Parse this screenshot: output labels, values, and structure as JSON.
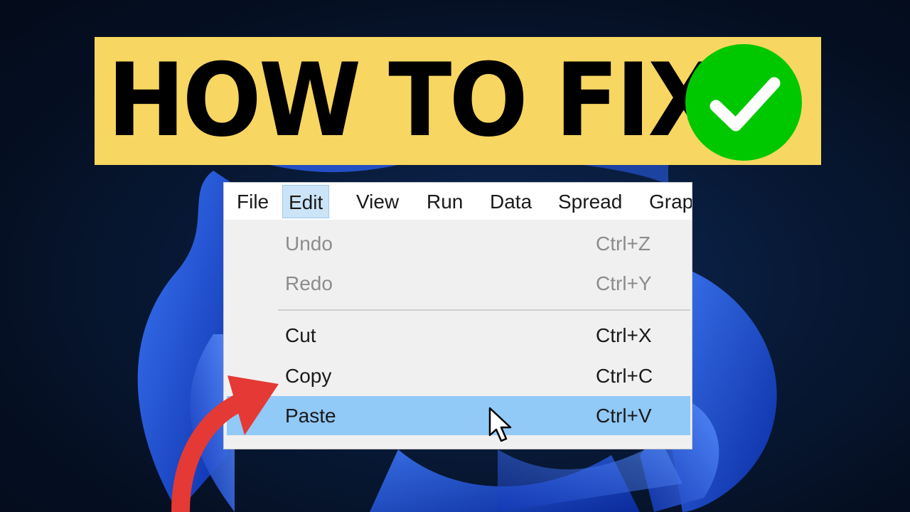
{
  "banner": {
    "title": "HOW TO FIX",
    "check_icon": "checkmark-circle-icon",
    "background": "#f7d661",
    "check_color": "#00c800"
  },
  "menubar": {
    "items": [
      {
        "label": "File"
      },
      {
        "label": "Edit"
      },
      {
        "label": "View"
      },
      {
        "label": "Run"
      },
      {
        "label": "Data"
      },
      {
        "label": "Spread"
      },
      {
        "label": "Grap"
      }
    ],
    "active_item": "Edit"
  },
  "edit_menu": {
    "items": [
      {
        "label": "Undo",
        "shortcut": "Ctrl+Z",
        "enabled": false
      },
      {
        "label": "Redo",
        "shortcut": "Ctrl+Y",
        "enabled": false
      },
      {
        "label": "Cut",
        "shortcut": "Ctrl+X",
        "enabled": true
      },
      {
        "label": "Copy",
        "shortcut": "Ctrl+C",
        "enabled": true
      },
      {
        "label": "Paste",
        "shortcut": "Ctrl+V",
        "enabled": true,
        "highlighted": true
      }
    ],
    "highlight_color": "#91c9f7"
  },
  "annotations": {
    "arrow_icon": "curved-arrow-icon",
    "arrow_color": "#e53935",
    "cursor_icon": "mouse-pointer-icon"
  }
}
